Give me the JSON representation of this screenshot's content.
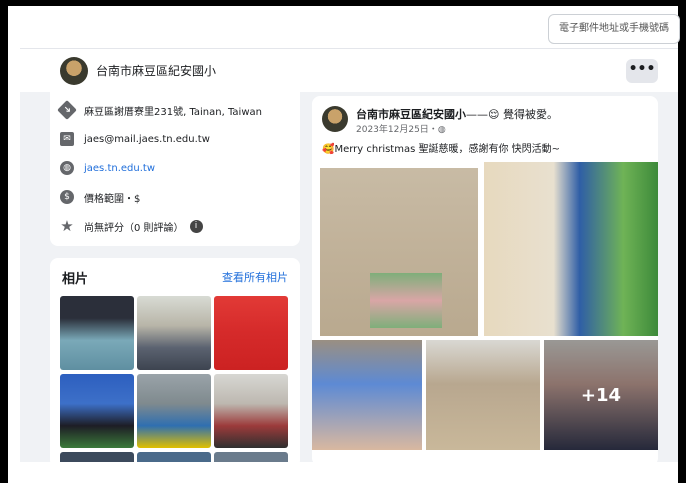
{
  "top_button": {
    "label": "電子郵件地址或手機號碼"
  },
  "page": {
    "name": "台南市麻豆區紀安國小",
    "more_label": "•••"
  },
  "info": {
    "address": "麻豆區謝厝寮里231號, Tainan, Taiwan",
    "email": "jaes@mail.jaes.tn.edu.tw",
    "website": "jaes.tn.edu.tw",
    "price": "價格範圍・$",
    "rating": "尚無評分（0 則評論）",
    "rating_info_icon": "i"
  },
  "photos": {
    "title": "相片",
    "see_all": "查看所有相片"
  },
  "post": {
    "author": "台南市麻豆區紀安國小",
    "feeling": "——😌 覺得被愛。",
    "date": "2023年12月25日・",
    "text": "🥰Merry christmas 聖誕慈暖，感謝有你 快閃活動~",
    "more_count": "+14"
  },
  "colors": {
    "accent": "#216fdb",
    "background": "#f0f2f5"
  }
}
